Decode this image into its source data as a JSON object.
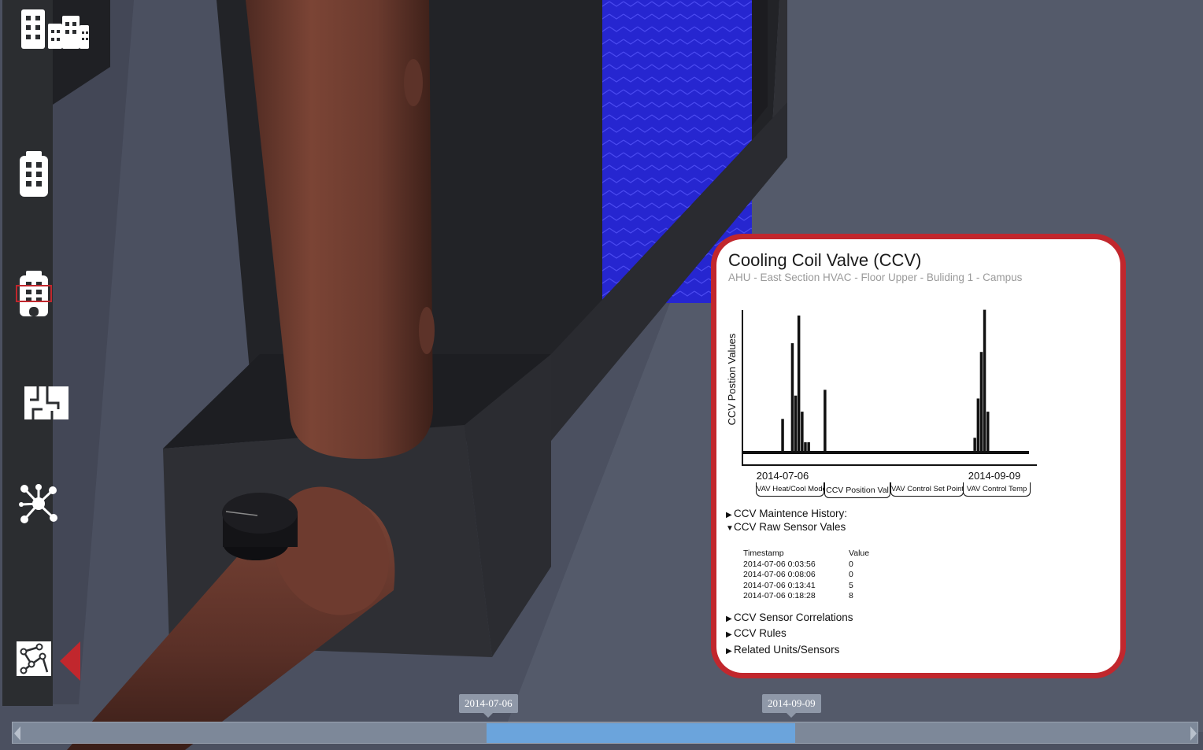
{
  "panel": {
    "title": "Cooling Coil Valve (CCV)",
    "subtitle": "AHU - East Section HVAC - Floor Upper - Buliding 1 - Campus",
    "tabs": [
      {
        "label": "VAV Heat/Cool Mode",
        "active": false
      },
      {
        "label": "CCV Position Val",
        "active": true
      },
      {
        "label": "VAV Control Set Point",
        "active": false
      },
      {
        "label": "VAV Control Temp",
        "active": false
      }
    ],
    "sections": {
      "maintenance": "CCV Maintence History:",
      "raw": "CCV Raw Sensor Vales",
      "correlations": "CCV Sensor Correlations",
      "rules": "CCV Rules",
      "related": "Related Units/Sensors"
    },
    "raw_table": {
      "headers": [
        "Timestamp",
        "Value"
      ],
      "rows": [
        [
          "2014-07-06 0:03:56",
          "0"
        ],
        [
          "2014-07-06 0:08:06",
          "0"
        ],
        [
          "2014-07-06 0:13:41",
          "5"
        ],
        [
          "2014-07-06 0:18:28",
          "8"
        ]
      ]
    }
  },
  "chart_data": {
    "type": "bar",
    "ylabel": "CCV Postion Values",
    "x_tick_labels": [
      "2014-07-06",
      "2014-09-09"
    ],
    "x": [
      "2014-07-06",
      "2014-07-09",
      "2014-07-10",
      "2014-07-11",
      "2014-07-12",
      "2014-07-13",
      "2014-07-14",
      "2014-07-19",
      "2014-09-03",
      "2014-09-04",
      "2014-09-05",
      "2014-09-06",
      "2014-09-07"
    ],
    "values": [
      0.22,
      0.74,
      0.38,
      0.93,
      0.27,
      0.06,
      0.06,
      0.42,
      0.09,
      0.36,
      0.68,
      0.97,
      0.27
    ],
    "ylim": [
      0,
      1
    ],
    "grid": false
  },
  "timeline": {
    "start_label": "2014-07-06",
    "end_label": "2014-09-09",
    "range_start": 0.4,
    "range_end": 0.66
  },
  "sidebar": {
    "items": [
      {
        "icon": "campus-buildings-icon",
        "active": false
      },
      {
        "icon": "building-icon",
        "active": false
      },
      {
        "icon": "building-floor-icon",
        "active": false
      },
      {
        "icon": "floor-plan-icon",
        "active": false
      },
      {
        "icon": "network-hub-icon",
        "active": false
      },
      {
        "icon": "sensor-network-icon",
        "active": true
      }
    ]
  },
  "colors": {
    "accent": "#c1272d",
    "timeline_range": "#6ba4dc",
    "coil": "#2a2ad6",
    "pipe": "#6e3b2f"
  }
}
